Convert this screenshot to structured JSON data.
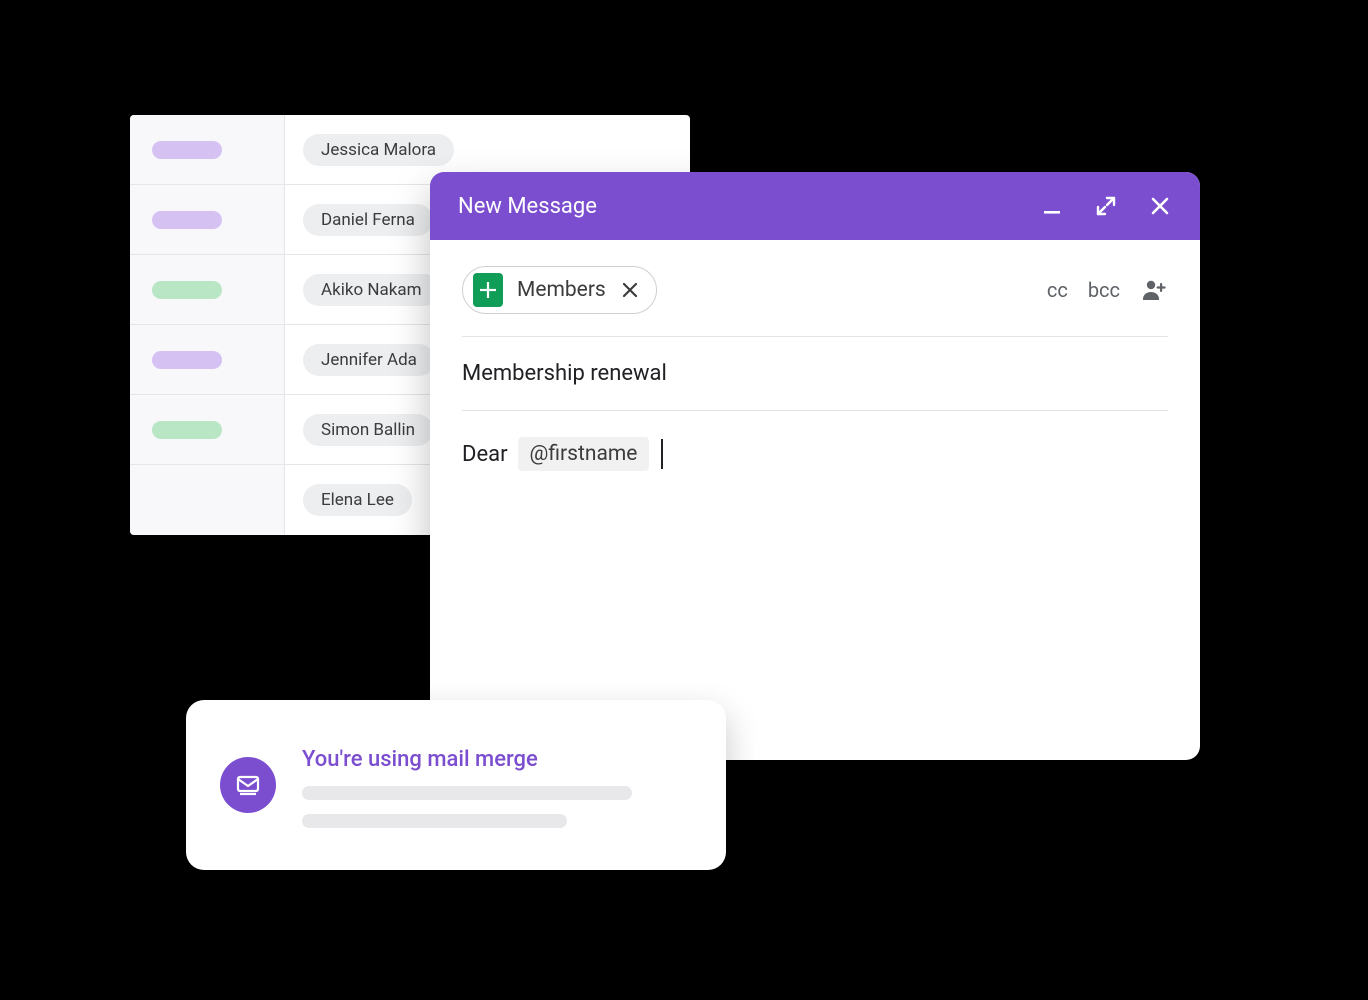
{
  "spreadsheet": {
    "rows": [
      {
        "status_color": "lav",
        "name": "Jessica Malora"
      },
      {
        "status_color": "lav",
        "name": "Daniel Ferna"
      },
      {
        "status_color": "grn",
        "name": "Akiko Nakam"
      },
      {
        "status_color": "lav",
        "name": "Jennifer Ada"
      },
      {
        "status_color": "grn",
        "name": "Simon Ballin"
      },
      {
        "status_color": "",
        "name": "Elena Lee"
      }
    ]
  },
  "compose": {
    "title": "New Message",
    "to_chip_label": "Members",
    "cc_label": "cc",
    "bcc_label": "bcc",
    "subject": "Membership renewal",
    "body_prefix": "Dear",
    "merge_tag": "@firstname"
  },
  "notification": {
    "title": "You're using mail merge"
  },
  "colors": {
    "accent": "#7b4ed0",
    "sheets_green": "#0f9d58",
    "pill_lavender": "#d5c2f3",
    "pill_green": "#b9e6c4"
  }
}
